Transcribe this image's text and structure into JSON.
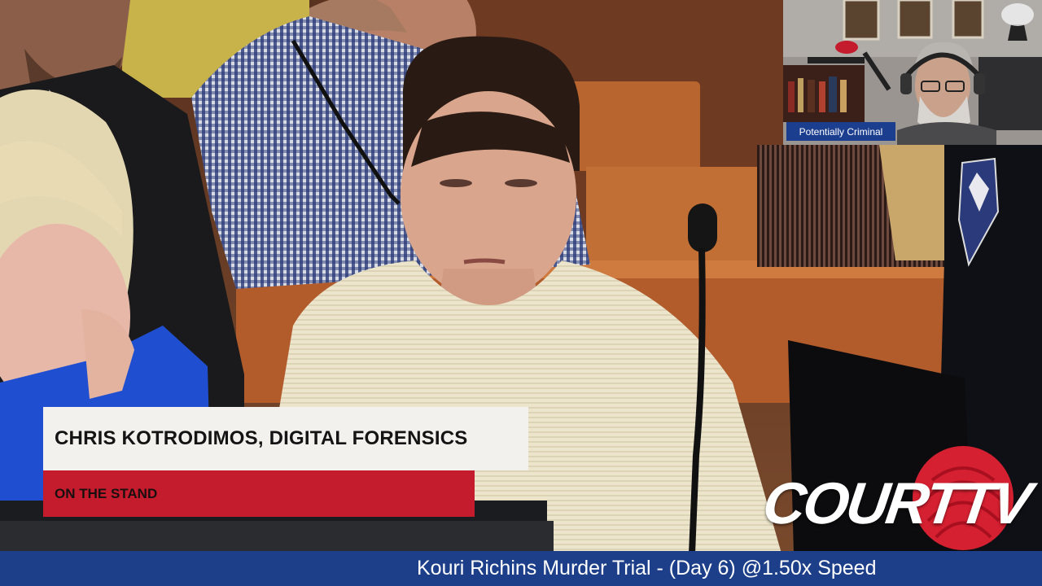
{
  "lower_third": {
    "name": "CHRIS KOTRODIMOS, DIGITAL FORENSICS",
    "tag": "ON THE STAND"
  },
  "ticker": {
    "text": "Kouri Richins Murder Trial - (Day 6) @1.50x Speed"
  },
  "inset": {
    "label": "Potentially Criminal"
  },
  "logo": {
    "text": "COURTTV"
  },
  "colors": {
    "ticker_blue": "#1d3f8a",
    "lower_third_red": "#c41c2c",
    "lower_third_white": "#f3f1ee",
    "logo_red": "#d42030"
  }
}
